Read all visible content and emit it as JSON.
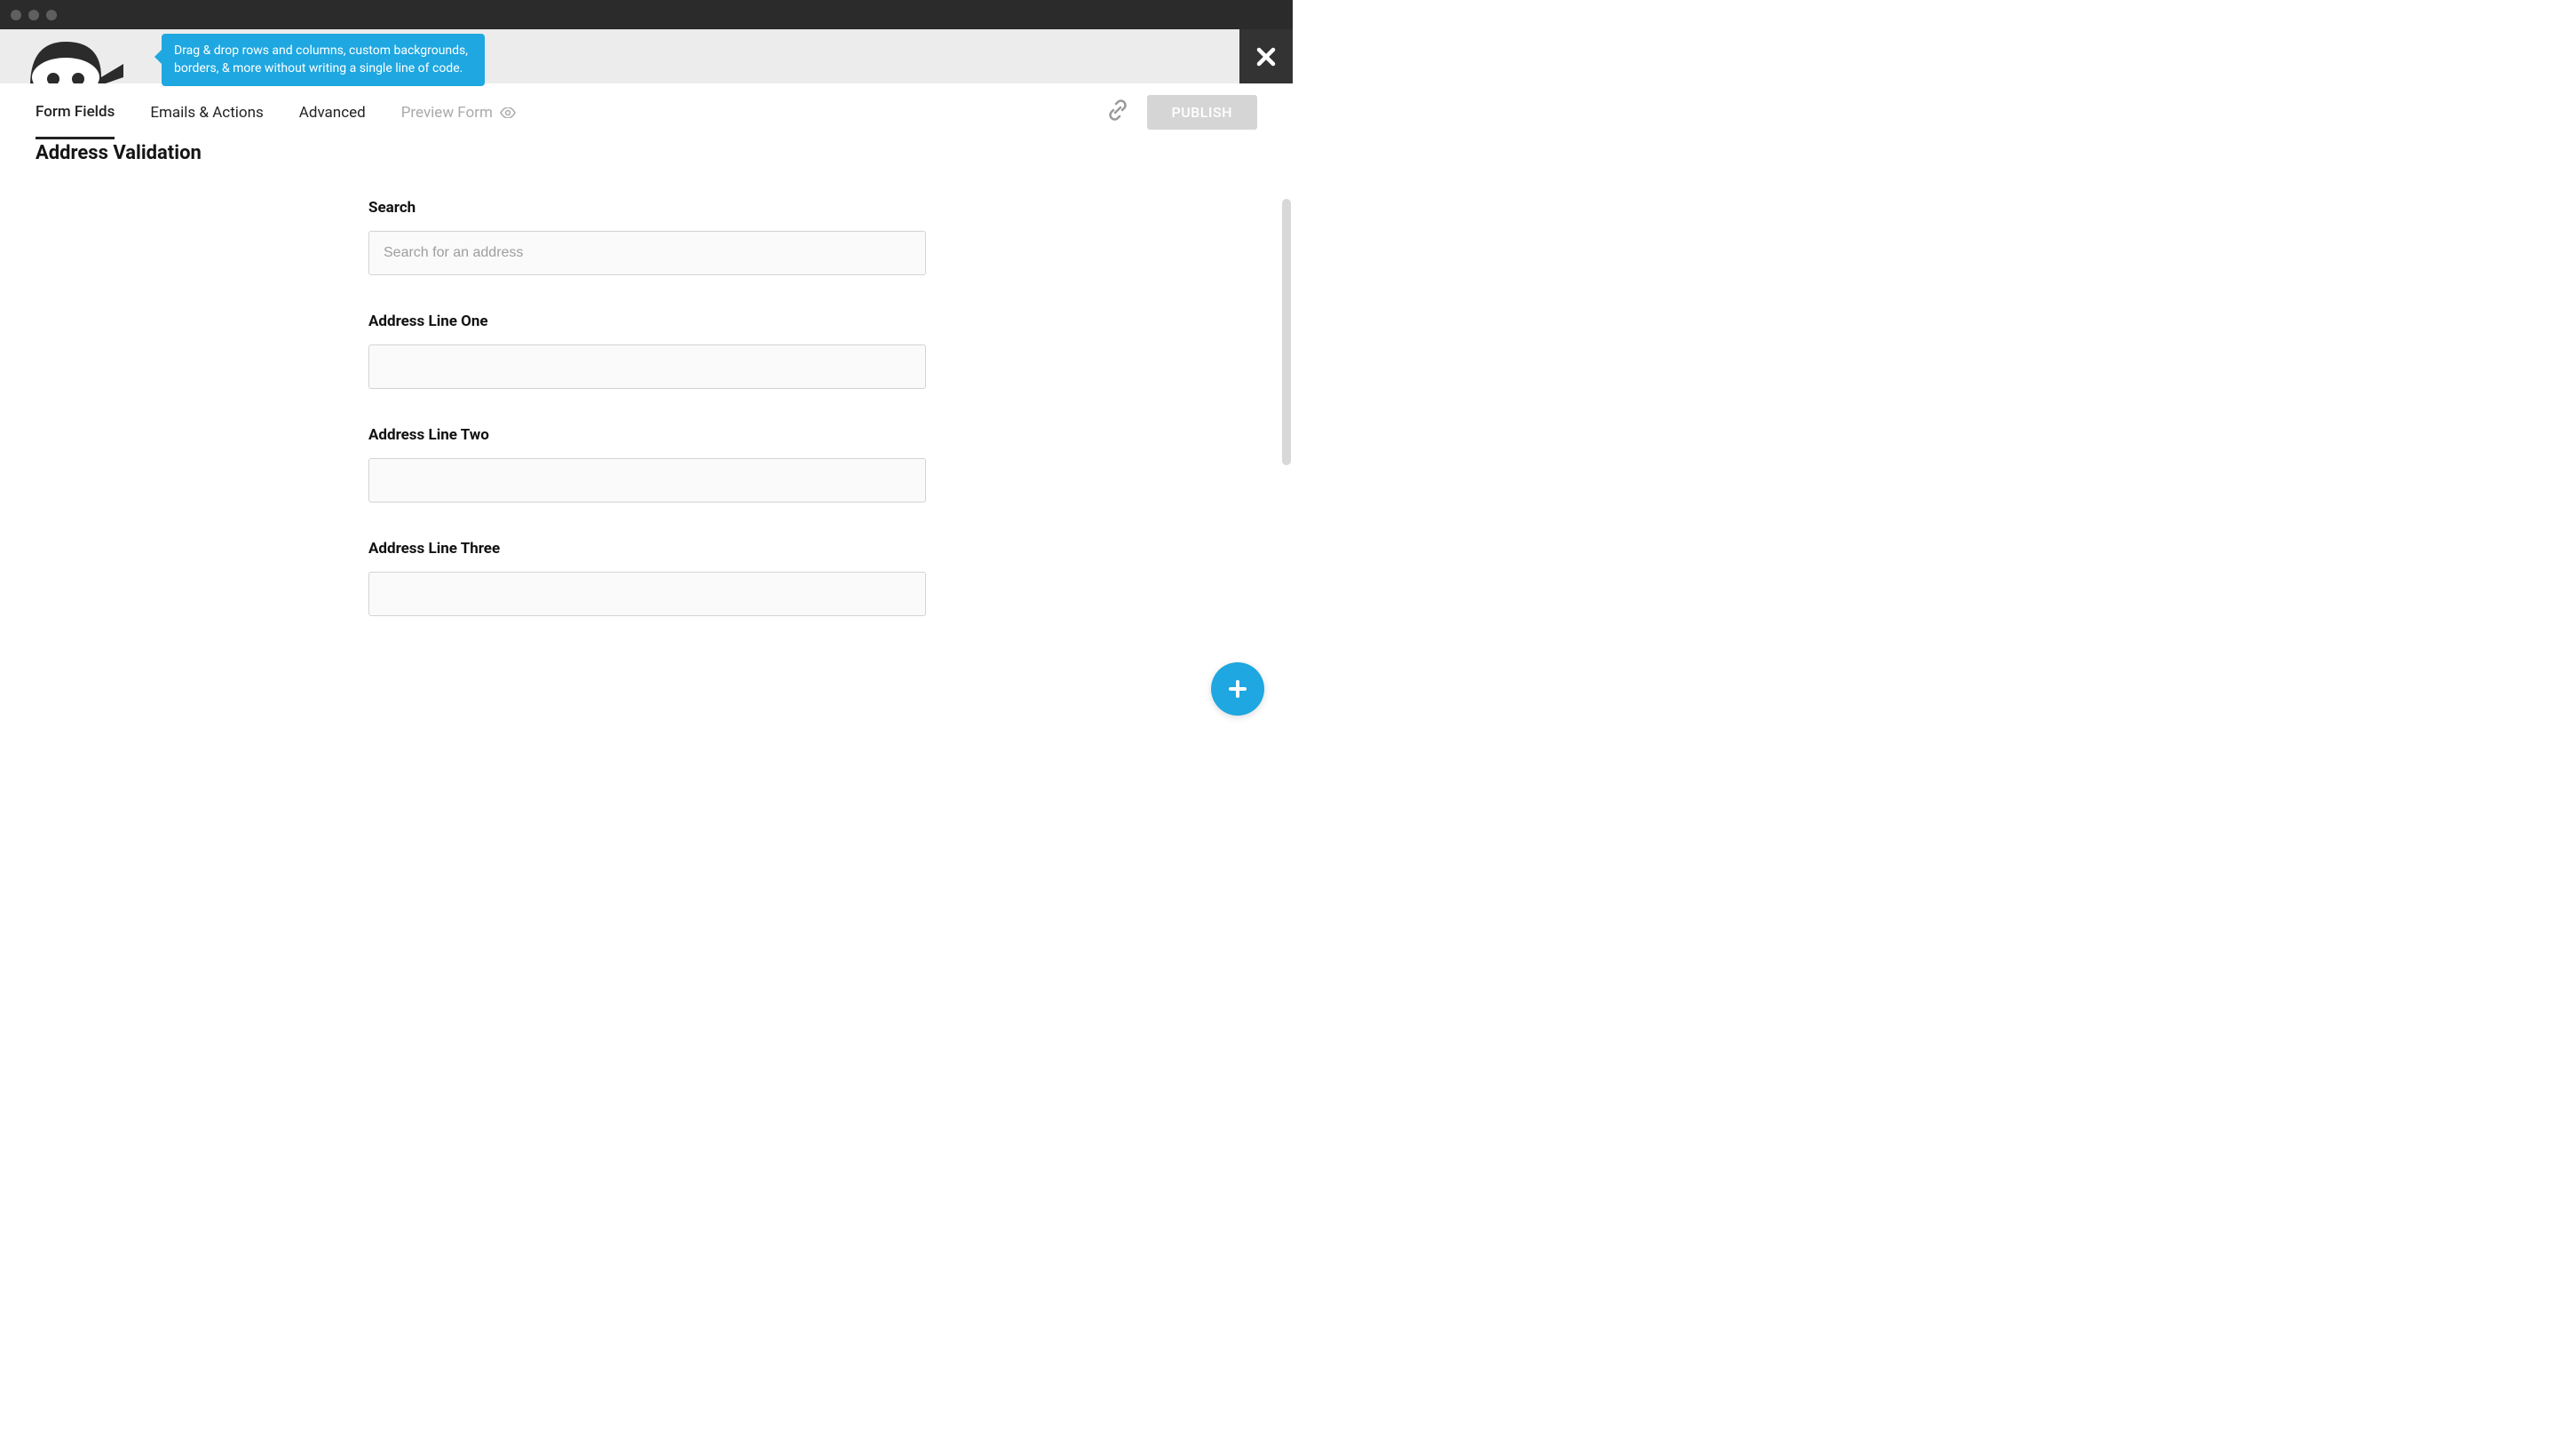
{
  "tooltip": {
    "text": "Drag & drop rows and columns, custom backgrounds, borders, & more without writing a single line of code."
  },
  "tabs": {
    "form_fields": "Form Fields",
    "emails_actions": "Emails & Actions",
    "advanced": "Advanced",
    "preview_form": "Preview Form"
  },
  "actions": {
    "publish": "PUBLISH"
  },
  "page": {
    "title": "Address Validation"
  },
  "fields": {
    "search": {
      "label": "Search",
      "placeholder": "Search for an address",
      "value": ""
    },
    "addr1": {
      "label": "Address Line One",
      "value": ""
    },
    "addr2": {
      "label": "Address Line Two",
      "value": ""
    },
    "addr3": {
      "label": "Address Line Three",
      "value": ""
    }
  }
}
